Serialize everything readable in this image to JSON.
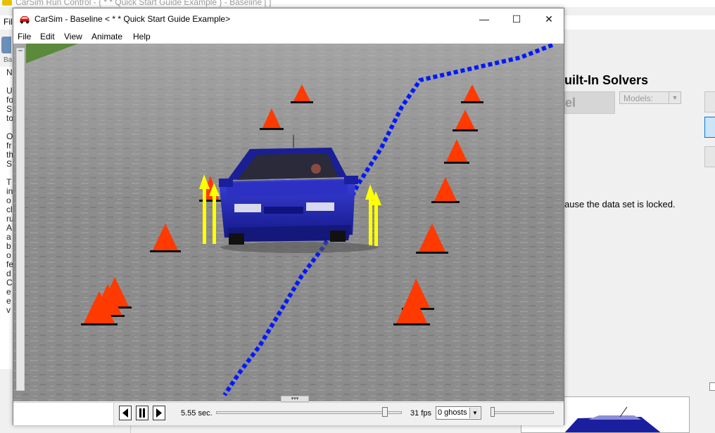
{
  "background_window": {
    "title": "CarSim Run Control - { * * Quick Start Guide Example } - Baseline [ ]",
    "menu_file": "File",
    "back_label": "Ba",
    "left_text": "N\n\nU\nfo\nS\nto\n\nO\nfr\nth\nS\n\nT\nin\no\ncl\nru\nA\na\nb\no\nfe\nd\nC\ne\ne\nv",
    "solvers_title": "uilt-In Solvers",
    "gray_button": "el",
    "models_label": "Models:",
    "locked_text": "ause the data set is locked."
  },
  "window": {
    "title": "CarSim - Baseline < * * Quick Start Guide Example>",
    "minimize": "—",
    "maximize": "☐",
    "close": "✕"
  },
  "menu": [
    "File",
    "Edit",
    "View",
    "Animate",
    "Help"
  ],
  "playback": {
    "time": "5.55 sec.",
    "progress": 0.92,
    "fps": "31 fps",
    "ghosts": "0 ghosts",
    "ghost_level": 0.0
  },
  "colors": {
    "cone": "#ff3a00",
    "path": "#0018ff",
    "arrow": "#ffff00",
    "car": "#1a1fa0"
  }
}
